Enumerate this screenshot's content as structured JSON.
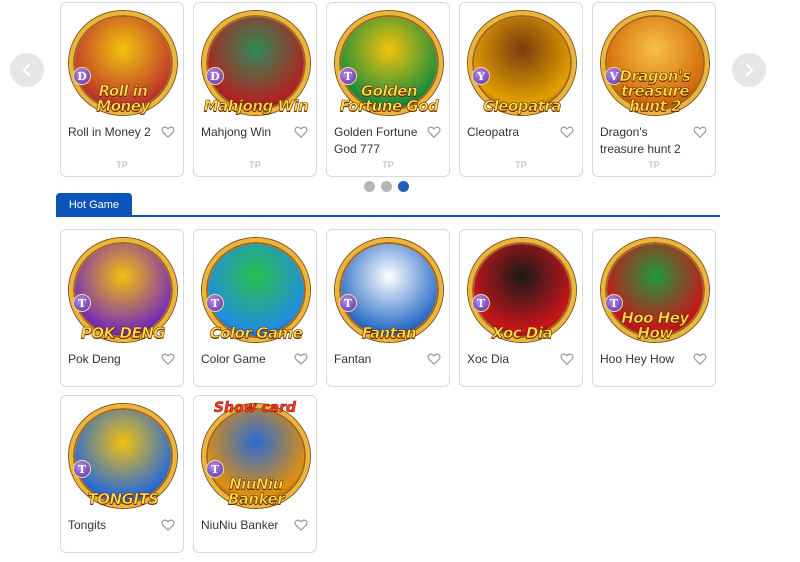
{
  "carousel": {
    "games": [
      {
        "name": "Roll in Money 2",
        "logo": "Roll in Money",
        "badge": "D",
        "provider": "TP",
        "colors": [
          "#c0392b",
          "#f1c40f"
        ]
      },
      {
        "name": "Mahjong Win",
        "logo": "Mahjong Win",
        "badge": "D",
        "provider": "TP",
        "colors": [
          "#b22222",
          "#2e8b57"
        ]
      },
      {
        "name": "Golden Fortune God 777",
        "logo": "Golden Fortune God",
        "badge": "T",
        "provider": "TP",
        "colors": [
          "#1e8f3a",
          "#f4c20d"
        ]
      },
      {
        "name": "Cleopatra",
        "logo": "Cleopatra",
        "badge": "Y",
        "provider": "TP",
        "colors": [
          "#e2a000",
          "#7a3b10"
        ]
      },
      {
        "name": "Dragon's treasure hunt 2",
        "logo": "Dragon's treasure hunt 2",
        "badge": "V",
        "provider": "TP",
        "colors": [
          "#d46a0a",
          "#f6c244"
        ]
      }
    ],
    "prev_icon": "chevron-left-icon",
    "next_icon": "chevron-right-icon",
    "pages": 3,
    "active_page": 3
  },
  "hot": {
    "tab_label": "Hot Game",
    "games": [
      {
        "name": "Pok Deng",
        "logo": "POK DENG",
        "badge": "T",
        "colors": [
          "#7a2fb5",
          "#f3c10d"
        ]
      },
      {
        "name": "Color Game",
        "logo": "Color Game",
        "badge": "T",
        "colors": [
          "#1f8de0",
          "#2cc04a"
        ]
      },
      {
        "name": "Fantan",
        "logo": "Fantan",
        "badge": "T",
        "colors": [
          "#2d6fc9",
          "#ffffff"
        ]
      },
      {
        "name": "Xoc Dia",
        "logo": "Xoc Dia",
        "badge": "T",
        "colors": [
          "#c8151b",
          "#1a1a1a"
        ]
      },
      {
        "name": "Hoo Hey How",
        "logo": "Hoo Hey How",
        "badge": "T",
        "colors": [
          "#c8151b",
          "#1f9a3a"
        ]
      },
      {
        "name": "Tongits",
        "logo": "TONGITS",
        "badge": "T",
        "colors": [
          "#2a6bd6",
          "#f3c10d"
        ]
      },
      {
        "name": "NiuNiu Banker",
        "logo": "NiuNiu Banker",
        "badge": "T",
        "colors": [
          "#e0900b",
          "#2a6bd6"
        ],
        "top_logo": "Show card"
      }
    ]
  },
  "colors": {
    "accent": "#0b54b8",
    "heart": "#9a9a9a",
    "gold": "#e8b73a"
  }
}
